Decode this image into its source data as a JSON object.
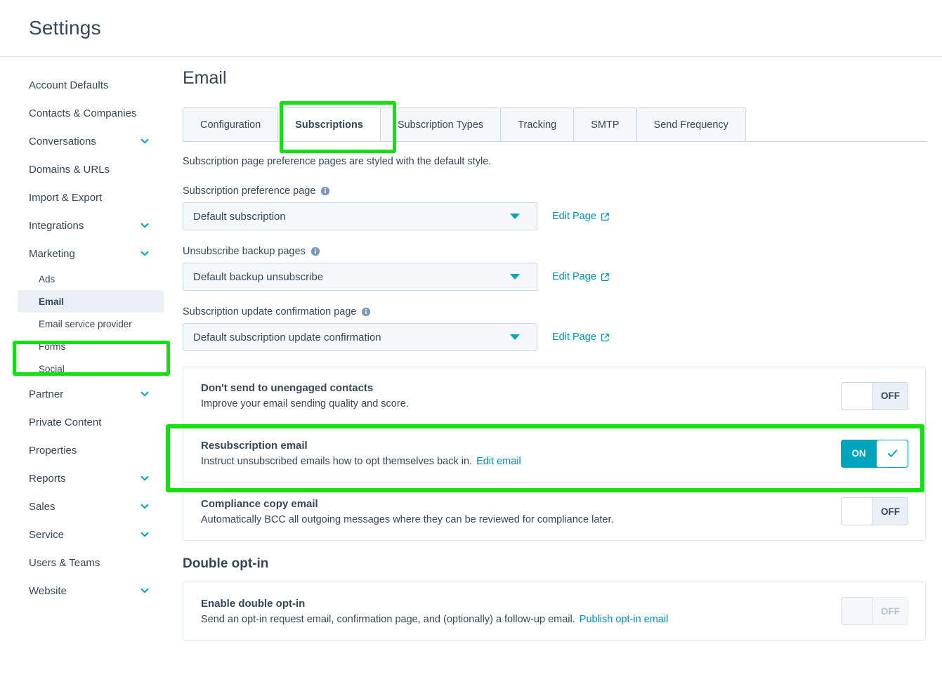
{
  "app": {
    "title": "Settings"
  },
  "sidebar": {
    "items": [
      {
        "label": "Account Defaults",
        "expandable": false,
        "sub": false
      },
      {
        "label": "Contacts & Companies",
        "expandable": false,
        "sub": false
      },
      {
        "label": "Conversations",
        "expandable": true,
        "sub": false
      },
      {
        "label": "Domains & URLs",
        "expandable": false,
        "sub": false
      },
      {
        "label": "Import & Export",
        "expandable": false,
        "sub": false
      },
      {
        "label": "Integrations",
        "expandable": true,
        "sub": false
      },
      {
        "label": "Marketing",
        "expandable": true,
        "sub": false
      },
      {
        "label": "Ads",
        "expandable": false,
        "sub": true
      },
      {
        "label": "Email",
        "expandable": false,
        "sub": true,
        "active": true
      },
      {
        "label": "Email service provider",
        "expandable": false,
        "sub": true
      },
      {
        "label": "Forms",
        "expandable": false,
        "sub": true
      },
      {
        "label": "Social",
        "expandable": false,
        "sub": true
      },
      {
        "label": "Partner",
        "expandable": true,
        "sub": false
      },
      {
        "label": "Private Content",
        "expandable": false,
        "sub": false
      },
      {
        "label": "Properties",
        "expandable": false,
        "sub": false
      },
      {
        "label": "Reports",
        "expandable": true,
        "sub": false
      },
      {
        "label": "Sales",
        "expandable": true,
        "sub": false
      },
      {
        "label": "Service",
        "expandable": true,
        "sub": false
      },
      {
        "label": "Users & Teams",
        "expandable": false,
        "sub": false
      },
      {
        "label": "Website",
        "expandable": true,
        "sub": false
      }
    ]
  },
  "main": {
    "section_title": "Email",
    "tabs": [
      {
        "label": "Configuration",
        "active": false
      },
      {
        "label": "Subscriptions",
        "active": true
      },
      {
        "label": "Subscription Types",
        "active": false
      },
      {
        "label": "Tracking",
        "active": false
      },
      {
        "label": "SMTP",
        "active": false
      },
      {
        "label": "Send Frequency",
        "active": false
      }
    ],
    "intro": "Subscription page preference pages are styled with the default style.",
    "fields": [
      {
        "label": "Subscription preference page",
        "info_icon": "info-icon",
        "value": "Default subscription",
        "link_label": "Edit Page",
        "link_icon": "external-link-icon"
      },
      {
        "label": "Unsubscribe backup pages",
        "info_icon": "info-icon",
        "value": "Default backup unsubscribe",
        "link_label": "Edit Page",
        "link_icon": "external-link-icon"
      },
      {
        "label": "Subscription update confirmation page",
        "info_icon": "info-icon",
        "value": "Default subscription update confirmation",
        "link_label": "Edit Page",
        "link_icon": "external-link-icon"
      }
    ],
    "toggle_rows": [
      {
        "title": "Don't send to unengaged contacts",
        "description": "Improve your email sending quality and score.",
        "inline_link": "",
        "state": "OFF",
        "state_mode": "off"
      },
      {
        "title": "Resubscription email",
        "description": "Instruct unsubscribed emails how to opt themselves back in.",
        "inline_link": "Edit email",
        "state": "ON",
        "state_mode": "on",
        "check_icon": "check-icon"
      },
      {
        "title": "Compliance copy email",
        "description": "Automatically BCC all outgoing messages where they can be reviewed for compliance later.",
        "inline_link": "",
        "state": "OFF",
        "state_mode": "off"
      }
    ],
    "double_optin": {
      "heading": "Double opt-in",
      "row": {
        "title": "Enable double opt-in",
        "description": "Send an opt-in request email, confirmation page, and (optionally) a follow-up email.",
        "inline_link": "Publish opt-in email",
        "state": "OFF",
        "state_mode": "disabled"
      }
    }
  },
  "colors": {
    "accent_teal": "#00a4bd",
    "link_teal": "#0091ae",
    "text": "#33475b",
    "highlight_green": "#12e012",
    "panel_border": "#dfe3eb",
    "tab_inactive_bg": "#f5f8fa",
    "sidebar_active_bg": "#eaf0f6"
  },
  "annotations": [
    {
      "name": "sidebar-email-highlight",
      "target": "Email"
    },
    {
      "name": "subscriptions-tab-highlight",
      "target": "Subscriptions"
    },
    {
      "name": "resubscription-row-highlight",
      "target": "Resubscription email"
    }
  ]
}
